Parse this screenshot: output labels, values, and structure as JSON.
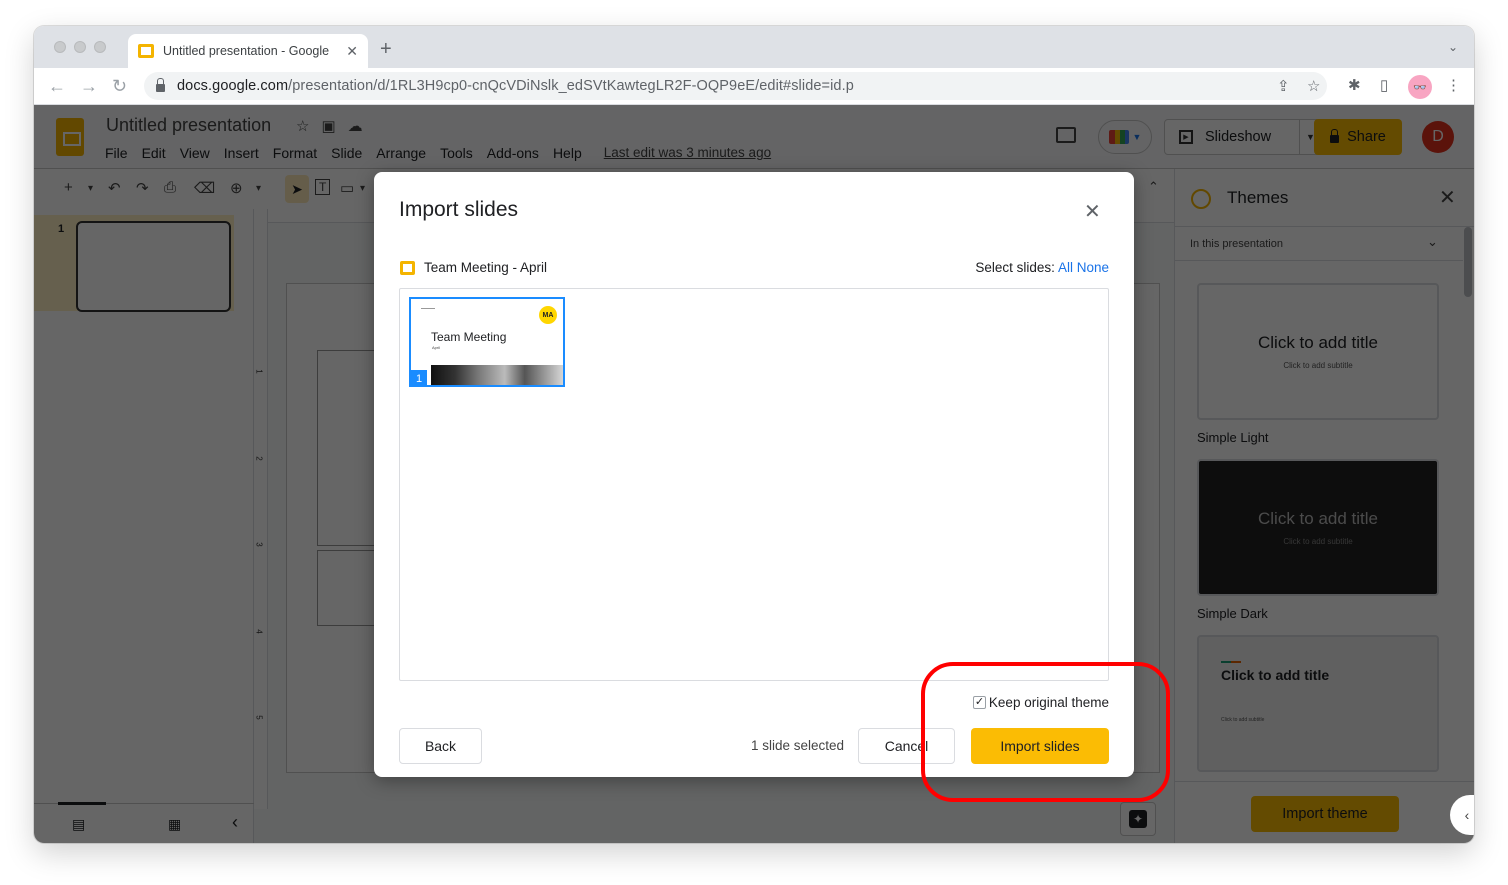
{
  "browser": {
    "tab_title": "Untitled presentation - Google",
    "new_tab_label": "+",
    "url_host": "docs.google.com",
    "url_path": "/presentation/d/1RL3H9cp0-cnQcVDiNslk_edSVtKawtegLR2F-OQP9eE/edit#slide=id.p",
    "icons": {
      "back": "←",
      "forward": "→",
      "reload": "↻",
      "share": "⇪",
      "star": "☆",
      "extensions": "✱",
      "sidebar": "▯",
      "menu": "⋮",
      "tab_search": "⌄",
      "close": "✕",
      "profile": "👓"
    }
  },
  "docs": {
    "title": "Untitled presentation",
    "title_icons": [
      "☆",
      "▣",
      "☁"
    ],
    "menu": [
      "File",
      "Edit",
      "View",
      "Insert",
      "Format",
      "Slide",
      "Arrange",
      "Tools",
      "Add-ons",
      "Help"
    ],
    "last_edit": "Last edit was 3 minutes ago",
    "slideshow_label": "Slideshow",
    "share_label": "Share",
    "avatar_initial": "D",
    "toolbar_icons": [
      "+",
      "▾",
      "↶",
      "↷",
      "⎙",
      "⌫",
      "⊕",
      "▾",
      "➤",
      "T",
      "▭",
      "▾"
    ],
    "collapse_icon": "⌃"
  },
  "filmstrip": {
    "slide_number": "1",
    "view_icons": {
      "filmstrip": "▤",
      "grid": "▦",
      "collapse": "‹"
    }
  },
  "ruler": {
    "vertical_numbers": [
      "1",
      "2",
      "3",
      "4",
      "5"
    ]
  },
  "themes_panel": {
    "title": "Themes",
    "filter_label": "In this presentation",
    "filter_chevron": "⌄",
    "themes": [
      {
        "name": "Simple Light",
        "title": "Click to add title",
        "subtitle": "Click to add subtitle"
      },
      {
        "name": "Simple Dark",
        "title": "Click to add title",
        "subtitle": "Click to add subtitle"
      },
      {
        "name": "",
        "title": "Click to add title",
        "subtitle": "Click to add subtitle"
      }
    ],
    "import_theme_label": "Import theme",
    "expand_icon": "‹"
  },
  "dialog": {
    "title": "Import slides",
    "close_icon": "✕",
    "source_name": "Team Meeting - April",
    "select_label": "Select slides:",
    "select_all": "All",
    "select_none": "None",
    "slides": [
      {
        "number": "1",
        "title": "Team Meeting",
        "subtitle": "April",
        "badge": "MA",
        "selected": true
      }
    ],
    "keep_theme_label": "Keep original theme",
    "keep_theme_checked": true,
    "back_label": "Back",
    "selected_count": "1 slide selected",
    "cancel_label": "Cancel",
    "import_label": "Import slides"
  },
  "colors": {
    "accent_yellow": "#fbbc04",
    "link_blue": "#1a73e8",
    "selection_blue": "#1a8cff",
    "annotation_red": "#ff0000",
    "avatar_red": "#e3311d"
  }
}
